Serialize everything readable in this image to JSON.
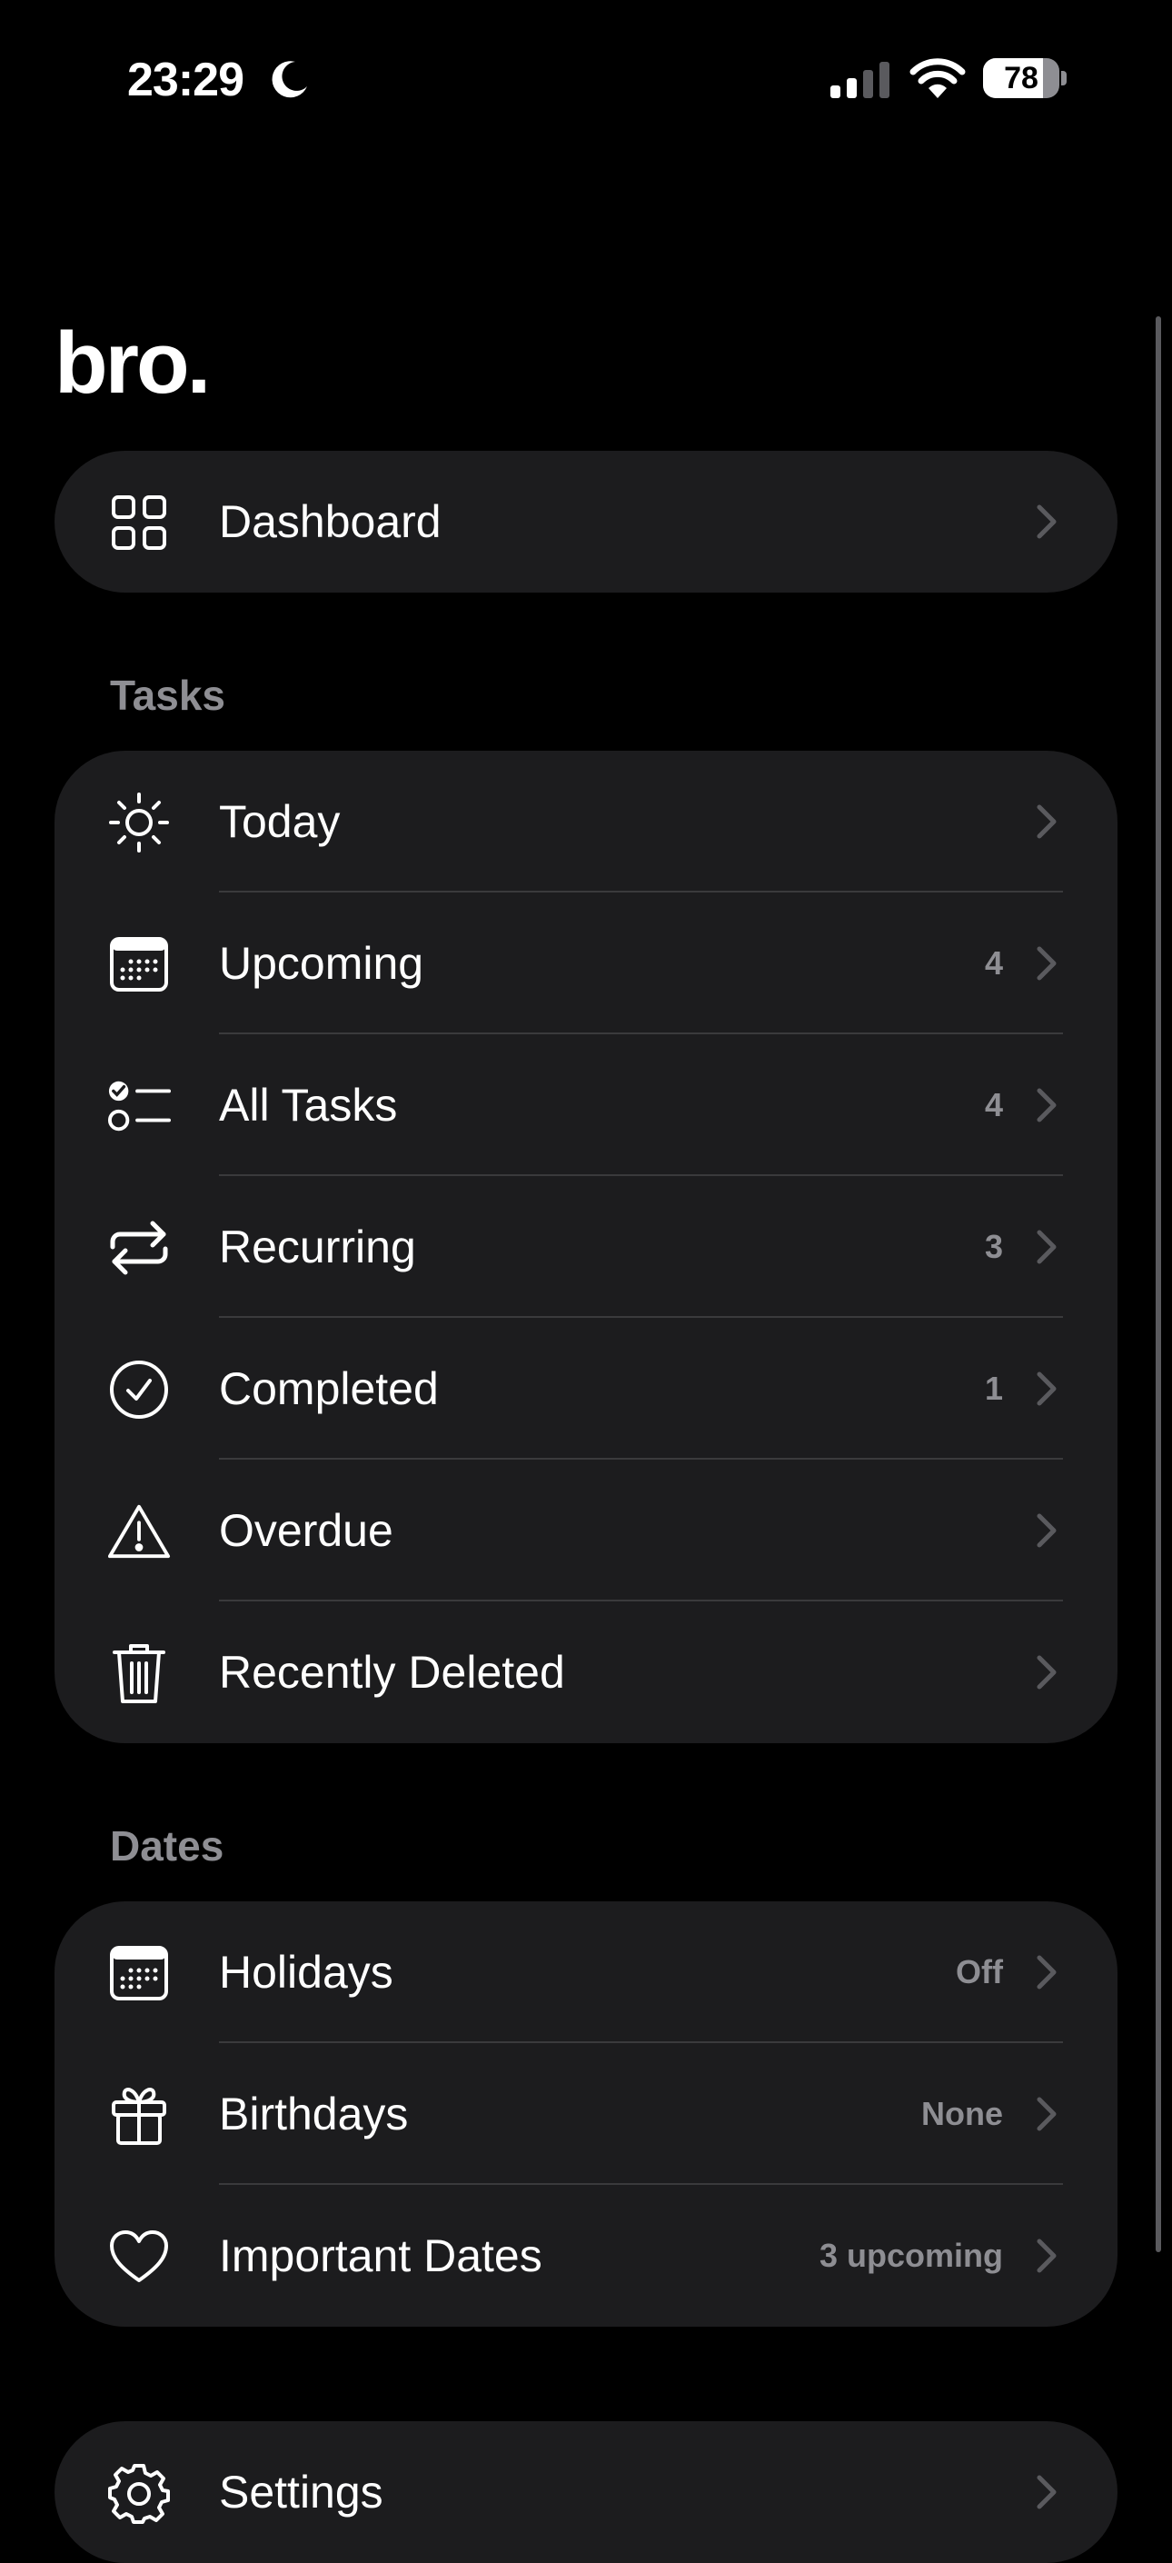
{
  "status_bar": {
    "time": "23:29",
    "battery": "78",
    "battery_level": 0.78
  },
  "app": {
    "title": "bro."
  },
  "dashboard": {
    "label": "Dashboard",
    "icon": "grid-icon"
  },
  "tasks": {
    "header": "Tasks",
    "items": [
      {
        "label": "Today",
        "value": "",
        "icon": "sun-icon"
      },
      {
        "label": "Upcoming",
        "value": "4",
        "icon": "calendar-icon"
      },
      {
        "label": "All Tasks",
        "value": "4",
        "icon": "checklist-icon"
      },
      {
        "label": "Recurring",
        "value": "3",
        "icon": "repeat-icon"
      },
      {
        "label": "Completed",
        "value": "1",
        "icon": "checkmark-circle-icon"
      },
      {
        "label": "Overdue",
        "value": "",
        "icon": "warning-triangle-icon"
      },
      {
        "label": "Recently Deleted",
        "value": "",
        "icon": "trash-icon"
      }
    ]
  },
  "dates": {
    "header": "Dates",
    "items": [
      {
        "label": "Holidays",
        "value": "Off",
        "icon": "calendar-icon"
      },
      {
        "label": "Birthdays",
        "value": "None",
        "icon": "gift-icon"
      },
      {
        "label": "Important Dates",
        "value": "3 upcoming",
        "icon": "heart-icon"
      }
    ]
  },
  "settings": {
    "label": "Settings",
    "icon": "gear-icon"
  },
  "colors": {
    "background": "#000000",
    "card": "#1c1c1e",
    "secondary_text": "#8e8e93",
    "separator": "#3a3a3c"
  }
}
